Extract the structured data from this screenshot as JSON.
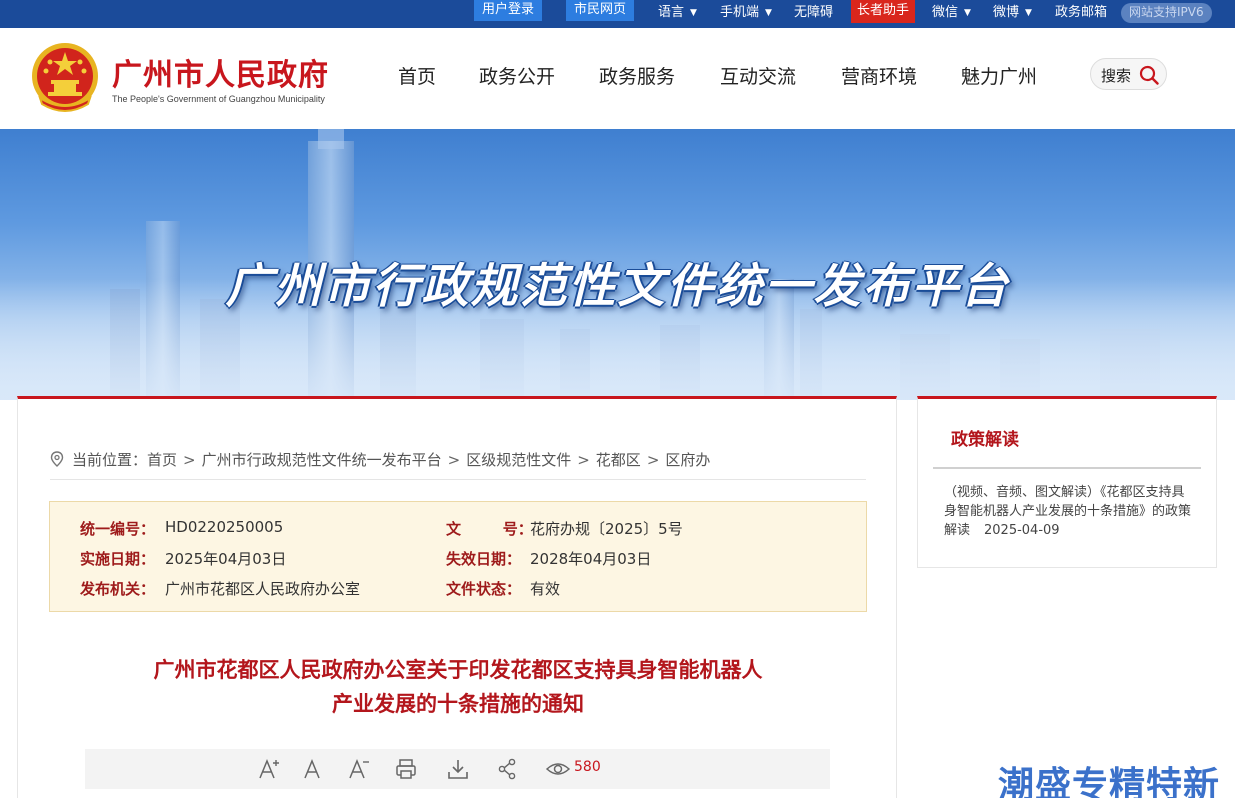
{
  "topbar": {
    "login": "用户登录",
    "citizen_page": "市民网页",
    "language": "语言",
    "mobile": "手机端",
    "accessibility": "无障碍",
    "elder_helper": "长者助手",
    "wechat": "微信",
    "weibo": "微博",
    "gov_mail": "政务邮箱",
    "ipv6": "网站支持IPV6"
  },
  "header": {
    "title": "广州市人民政府",
    "subtitle": "The People's Government of Guangzhou Municipality",
    "nav": [
      "首页",
      "政务公开",
      "政务服务",
      "互动交流",
      "营商环境",
      "魅力广州"
    ],
    "search_label": "搜索"
  },
  "banner": {
    "title": "广州市行政规范性文件统一发布平台"
  },
  "breadcrumb": {
    "prefix": "当前位置：",
    "items": [
      "首页",
      "广州市行政规范性文件统一发布平台",
      "区级规范性文件",
      "花都区",
      "区府办"
    ]
  },
  "info": {
    "serial_label": "统一编号：",
    "serial_value": "HD0220250005",
    "docno_label": "文        号：",
    "docno_value": "花府办规〔2025〕5号",
    "effective_label": "实施日期：",
    "effective_value": "2025年04月03日",
    "expire_label": "失效日期：",
    "expire_value": "2028年04月03日",
    "issuer_label": "发布机关：",
    "issuer_value": "广州市花都区人民政府办公室",
    "status_label": "文件状态：",
    "status_value": "有效"
  },
  "document": {
    "title_line1": "广州市花都区人民政府办公室关于印发花都区支持具身智能机器人",
    "title_line2": "产业发展的十条措施的通知",
    "view_count": "580"
  },
  "side": {
    "heading": "政策解读",
    "item_text": "（视频、音频、图文解读）《花都区支持具身智能机器人产业发展的十条措施》的政策解读",
    "item_date": "2025-04-09"
  },
  "watermark": "潮盛专精特新",
  "colors": {
    "topbar": "#1b4b9a",
    "brand_red": "#c8161d",
    "info_bg": "#fdf6e3"
  }
}
